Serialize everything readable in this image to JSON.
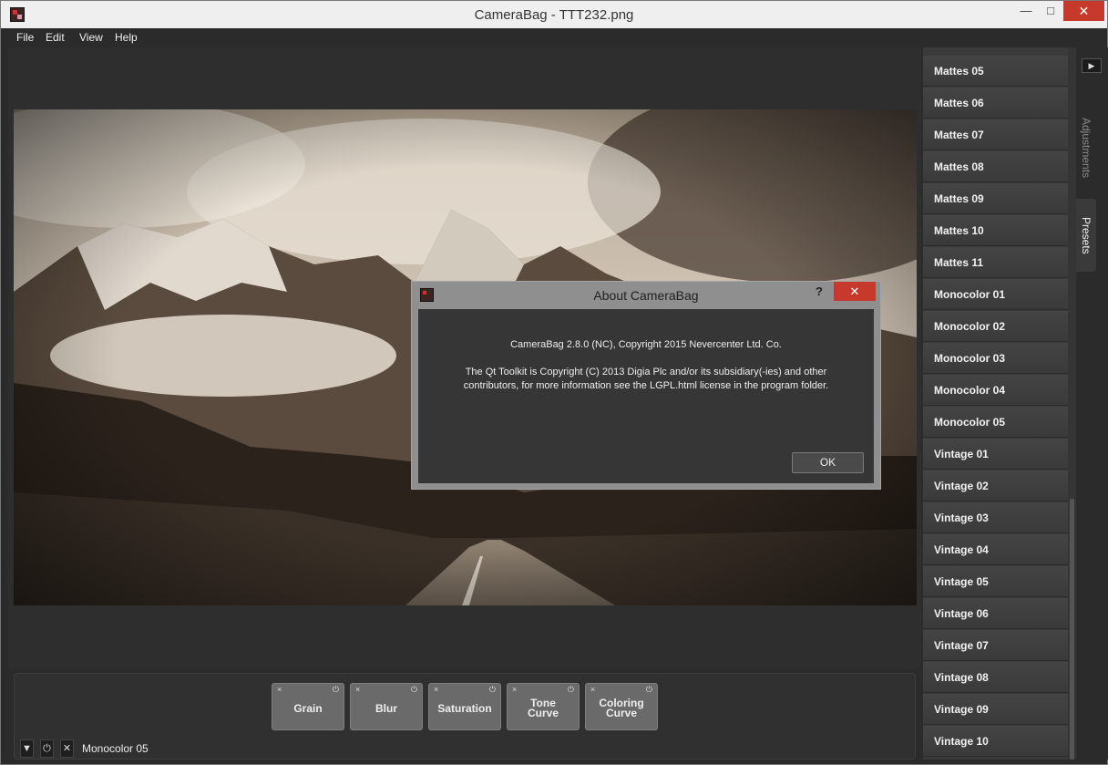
{
  "window": {
    "title": "CameraBag - TTT232.png",
    "min_icon": "—",
    "max_icon": "□",
    "close_icon": "✕"
  },
  "menu": [
    "File",
    "Edit",
    "View",
    "Help"
  ],
  "presets": [
    "Mattes 05",
    "Mattes 06",
    "Mattes 07",
    "Mattes 08",
    "Mattes 09",
    "Mattes 10",
    "Mattes 11",
    "Monocolor 01",
    "Monocolor 02",
    "Monocolor 03",
    "Monocolor 04",
    "Monocolor 05",
    "Vintage 01",
    "Vintage 02",
    "Vintage 03",
    "Vintage 04",
    "Vintage 05",
    "Vintage 06",
    "Vintage 07",
    "Vintage 08",
    "Vintage 09",
    "Vintage 10"
  ],
  "side_tabs": {
    "expand_icon": "▶",
    "adjustments": "Adjustments",
    "presets": "Presets"
  },
  "adjustments": [
    {
      "label": "Grain"
    },
    {
      "label": "Blur"
    },
    {
      "label": "Saturation"
    },
    {
      "label": "Tone\nCurve"
    },
    {
      "label": "Coloring\nCurve"
    }
  ],
  "adjustment_icons": {
    "remove": "×",
    "power": "⏻"
  },
  "bottom": {
    "dropdown_icon": "▼",
    "power_icon": "⏻",
    "remove_icon": "✕",
    "current_preset": "Monocolor 05"
  },
  "dialog": {
    "title": "About CameraBag",
    "help": "?",
    "close_icon": "✕",
    "line1": "CameraBag 2.8.0 (NC), Copyright 2015 Nevercenter Ltd. Co.",
    "line2": "The Qt Toolkit is Copyright (C) 2013 Digia Plc and/or its subsidiary(-ies) and other",
    "line3": "contributors, for more information see the LGPL.html license in the program folder.",
    "ok": "OK"
  }
}
